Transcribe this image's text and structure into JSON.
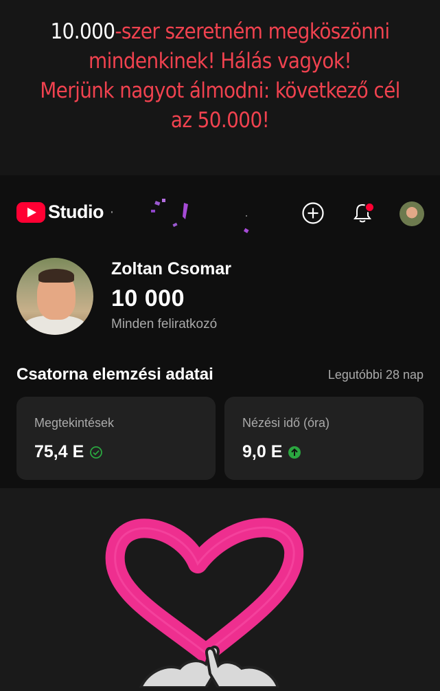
{
  "caption": {
    "line1_white": "10.000",
    "line1_red": "-szer szeretném megköszönni",
    "line2": "mindenkinek! Hálás vagyok!",
    "line3": "Merjünk nagyot álmodni: következő cél",
    "line4": "az 50.000!"
  },
  "topbar": {
    "logo_text": "Studio",
    "icons": [
      "create-icon",
      "notifications-icon",
      "account-avatar"
    ]
  },
  "profile": {
    "name": "Zoltan Csomar",
    "subscribers": "10 000",
    "subscribers_label": "Minden feliratkozó"
  },
  "analytics": {
    "title": "Csatorna elemzési adatai",
    "range": "Legutóbbi 28 nap",
    "cards": [
      {
        "label": "Megtekintések",
        "value": "75,4 E",
        "status_icon": "check-circle-icon"
      },
      {
        "label": "Nézési idő (óra)",
        "value": "9,0 E",
        "status_icon": "arrow-up-icon"
      }
    ]
  },
  "colors": {
    "caption_red": "#f0424f",
    "brand_red": "#ff0033",
    "heart_pink": "#ee2f8f",
    "up_green": "#2ba640"
  }
}
